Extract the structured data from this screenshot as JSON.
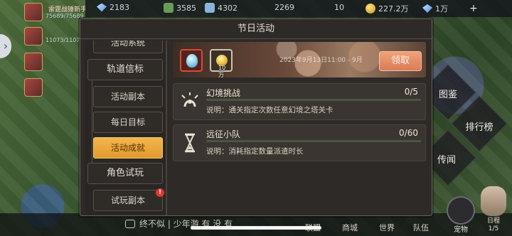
{
  "top_bar": {
    "res1": "2183",
    "res2": "3585",
    "res3": "4302",
    "res4": "2269",
    "res5": "10",
    "gold": "227.2万",
    "gems": "1万",
    "plus": "+",
    "colors": {
      "gold": "#e3b12a",
      "gem": "#5a8ed6"
    }
  },
  "left_list": [
    {
      "name": "雷霆战锤新手",
      "level": "75689/75689"
    },
    {
      "name": "",
      "level": "11073/11073"
    },
    {
      "name": "",
      "level": ""
    }
  ],
  "modal": {
    "title": "节日活动",
    "nav": {
      "groups": [
        {
          "label": "活动系统"
        },
        {
          "label": "轨道信标"
        }
      ],
      "subs": [
        {
          "label": "活动副本"
        },
        {
          "label": "每日目标"
        },
        {
          "label": "活动成就",
          "active": true
        }
      ],
      "group2": {
        "label": "角色试玩"
      },
      "sub2": {
        "label": "试玩副本"
      },
      "badge": "!"
    },
    "banner": {
      "date": "2023年9月13日11:00 - 9月",
      "reward2_amount": "10万",
      "claim_label": "领取",
      "accent": "#d97d55"
    },
    "tasks": [
      {
        "name": "幻境挑战",
        "progress": "0/5",
        "progress_value": 0,
        "description": "说明：通关指定次数任意幻境之塔关卡",
        "icon": "horseshoe-icon"
      },
      {
        "name": "远征小队",
        "progress": "0/60",
        "progress_value": 0,
        "description": "说明：消耗指定数量派遣时长",
        "icon": "hourglass-icon"
      }
    ]
  },
  "right_buttons": {
    "gallery": "图鉴",
    "ranking": "排行榜",
    "legend": "传闻"
  },
  "bottom": {
    "chat_text": "终不似 | 少年游 有 没 有",
    "nav": [
      "联盟",
      "商城",
      "世界",
      "队伍"
    ],
    "pet_label": "宠物",
    "profile_label": "日程",
    "profile_sub": "1/5"
  }
}
